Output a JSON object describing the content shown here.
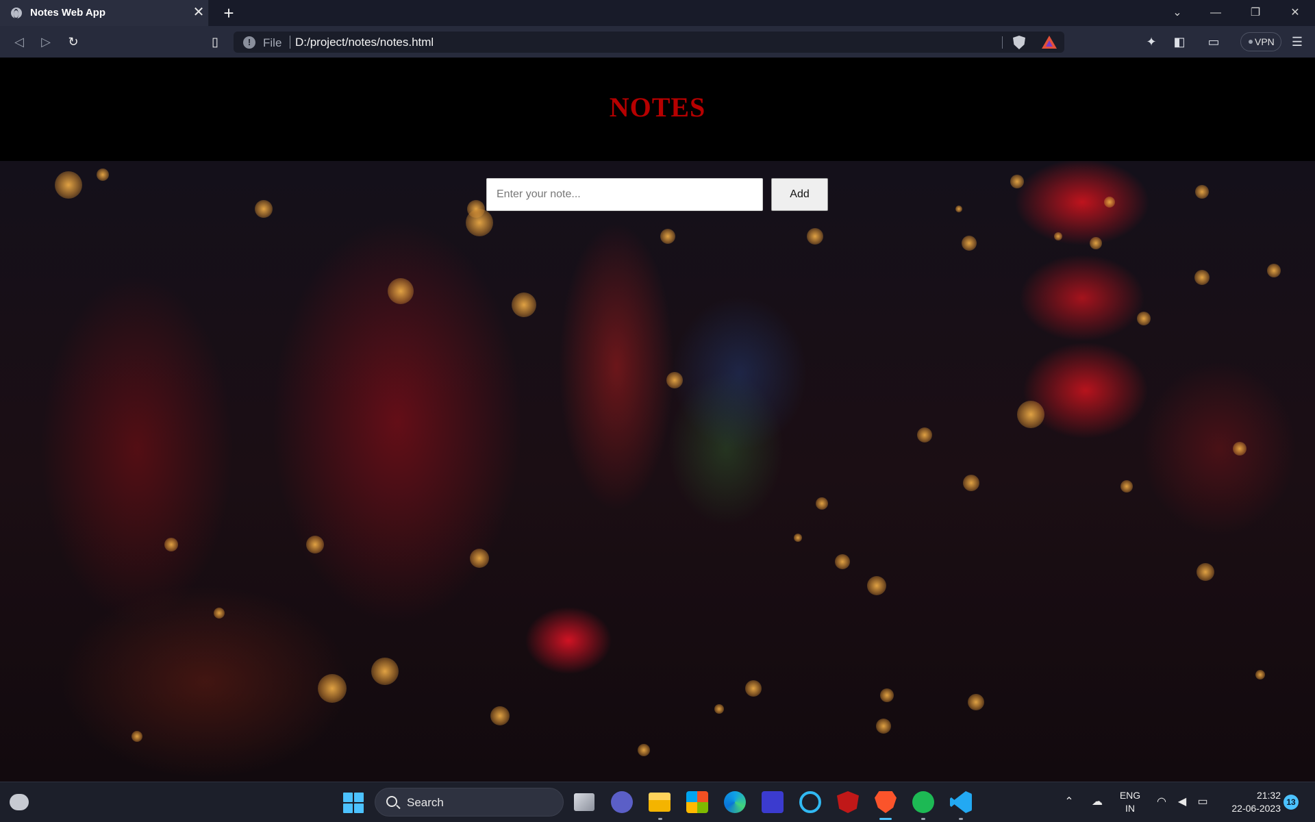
{
  "browser": {
    "tab_title": "Notes Web App",
    "tab_close": "✕",
    "new_tab": "+",
    "url_scheme": "File",
    "url": "D:/project/notes/notes.html",
    "vpn_label": "VPN",
    "window_controls": {
      "dropdown": "⌄",
      "minimize": "—",
      "restore": "❐",
      "close": "✕"
    }
  },
  "page": {
    "title": "NOTES",
    "title_color": "#b60000",
    "input_placeholder": "Enter your note...",
    "add_label": "Add"
  },
  "taskbar": {
    "search_label": "Search",
    "language_line1": "ENG",
    "language_line2": "IN",
    "time": "21:32",
    "date": "22-06-2023",
    "notification_count": "13",
    "pinned": [
      "task-view-icon",
      "teams-chat-icon",
      "file-explorer-icon",
      "microsoft-store-icon",
      "edge-icon",
      "app-icon",
      "cortana-icon",
      "mcafee-icon",
      "brave-icon",
      "spotify-icon",
      "vscode-icon"
    ]
  },
  "colors": {
    "accent": "#4cc2ff",
    "brave": "#fb542b",
    "spotify": "#1db954",
    "vscode": "#23a9f2"
  }
}
